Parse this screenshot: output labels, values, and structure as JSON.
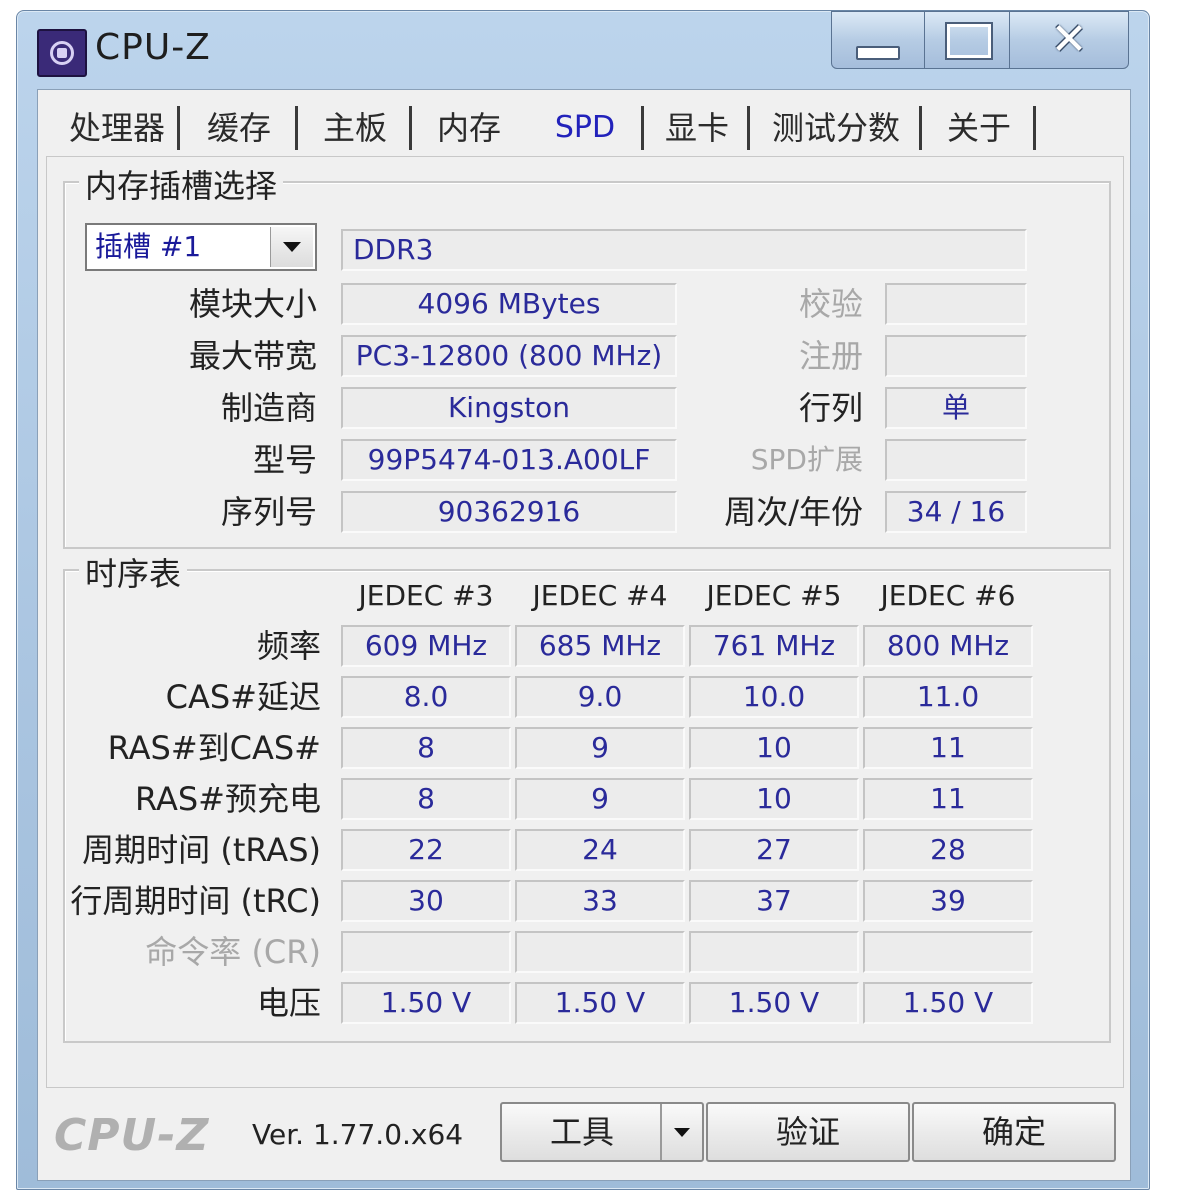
{
  "window": {
    "title": "CPU-Z"
  },
  "tabs": [
    {
      "label": "处理器"
    },
    {
      "label": "缓存"
    },
    {
      "label": "主板"
    },
    {
      "label": "内存"
    },
    {
      "label": "SPD",
      "active": true
    },
    {
      "label": "显卡"
    },
    {
      "label": "测试分数"
    },
    {
      "label": "关于"
    }
  ],
  "slot_group": {
    "title": "内存插槽选择",
    "slot_select": "插槽 #1",
    "memory_type": "DDR3",
    "rows": [
      {
        "label": "模块大小",
        "value": "4096 MBytes"
      },
      {
        "label": "最大带宽",
        "value": "PC3-12800 (800 MHz)"
      },
      {
        "label": "制造商",
        "value": "Kingston"
      },
      {
        "label": "型号",
        "value": "99P5474-013.A00LF"
      },
      {
        "label": "序列号",
        "value": "90362916"
      }
    ],
    "right_rows": [
      {
        "label": "校验",
        "value": "",
        "dim": true
      },
      {
        "label": "注册",
        "value": "",
        "dim": true
      },
      {
        "label": "行列",
        "value": "单",
        "dim": false
      },
      {
        "label": "SPD扩展",
        "value": "",
        "dim": true
      },
      {
        "label": "周次/年份",
        "value": "34 / 16",
        "dim": false
      }
    ]
  },
  "timing_group": {
    "title": "时序表",
    "columns": [
      "JEDEC #3",
      "JEDEC #4",
      "JEDEC #5",
      "JEDEC #6"
    ],
    "rows": [
      {
        "label": "频率",
        "values": [
          "609 MHz",
          "685 MHz",
          "761 MHz",
          "800 MHz"
        ]
      },
      {
        "label": "CAS#延迟",
        "values": [
          "8.0",
          "9.0",
          "10.0",
          "11.0"
        ]
      },
      {
        "label": "RAS#到CAS#",
        "values": [
          "8",
          "9",
          "10",
          "11"
        ]
      },
      {
        "label": "RAS#预充电",
        "values": [
          "8",
          "9",
          "10",
          "11"
        ]
      },
      {
        "label": "周期时间 (tRAS)",
        "values": [
          "22",
          "24",
          "27",
          "28"
        ]
      },
      {
        "label": "行周期时间 (tRC)",
        "values": [
          "30",
          "33",
          "37",
          "39"
        ]
      },
      {
        "label": "命令率 (CR)",
        "values": [
          "",
          "",
          "",
          ""
        ],
        "dim": true
      },
      {
        "label": "电压",
        "values": [
          "1.50 V",
          "1.50 V",
          "1.50 V",
          "1.50 V"
        ]
      }
    ]
  },
  "footer": {
    "brand": "CPU-Z",
    "version": "Ver. 1.77.0.x64",
    "tools_button": "工具",
    "validate_button": "验证",
    "ok_button": "确定"
  }
}
